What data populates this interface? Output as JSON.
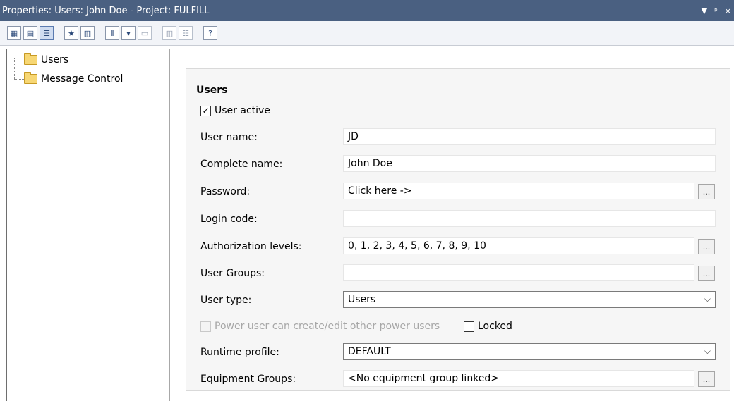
{
  "window": {
    "title": "Properties: Users: John Doe - Project: FULFILL",
    "ctrl_dropdown": "▼",
    "ctrl_pin": "ᵖ",
    "ctrl_close": "×"
  },
  "toolbar": {
    "buttons": [
      {
        "icon": "categorized-icon",
        "glyph": "▦"
      },
      {
        "icon": "page-icon",
        "glyph": "▤"
      },
      {
        "icon": "properties-pages-icon",
        "glyph": "☰"
      },
      {
        "icon": "favorites-icon",
        "glyph": "★"
      },
      {
        "icon": "grid-icon",
        "glyph": "▥"
      },
      {
        "icon": "text-field-icon",
        "glyph": "Ⅱ"
      },
      {
        "icon": "dropdown-field-icon",
        "glyph": "▾"
      },
      {
        "icon": "edit-field-icon",
        "glyph": "▭"
      },
      {
        "icon": "columns-icon",
        "glyph": "▥"
      },
      {
        "icon": "list-icon",
        "glyph": "☷"
      },
      {
        "icon": "help-icon",
        "glyph": "?"
      }
    ]
  },
  "tree": {
    "items": [
      {
        "label": "Users"
      },
      {
        "label": "Message Control"
      }
    ]
  },
  "form": {
    "group_title": "Users",
    "user_active": {
      "label": "User active",
      "checked": "✓"
    },
    "rows": [
      {
        "label": "User name:",
        "value": "JD"
      },
      {
        "label": "Complete name:",
        "value": "John Doe"
      },
      {
        "label": "Password:",
        "value": "Click here ->",
        "button": "..."
      },
      {
        "label": "Login code:",
        "value": ""
      },
      {
        "label": "Authorization levels:",
        "value": "0, 1, 2, 3, 4, 5, 6, 7, 8, 9, 10",
        "button": "..."
      },
      {
        "label": "User Groups:",
        "value": "",
        "button": "..."
      },
      {
        "label": "User type:",
        "value": "Users",
        "chevron": "⌵"
      }
    ],
    "power_user": {
      "label": "Power user can create/edit other power users",
      "checked": ""
    },
    "locked": {
      "label": "Locked",
      "checked": ""
    },
    "runtime_profile": {
      "label": "Runtime profile:",
      "value": "DEFAULT",
      "chevron": "⌵"
    },
    "equipment_groups": {
      "label": "Equipment Groups:",
      "value": "<No equipment group linked>",
      "button": "..."
    }
  }
}
